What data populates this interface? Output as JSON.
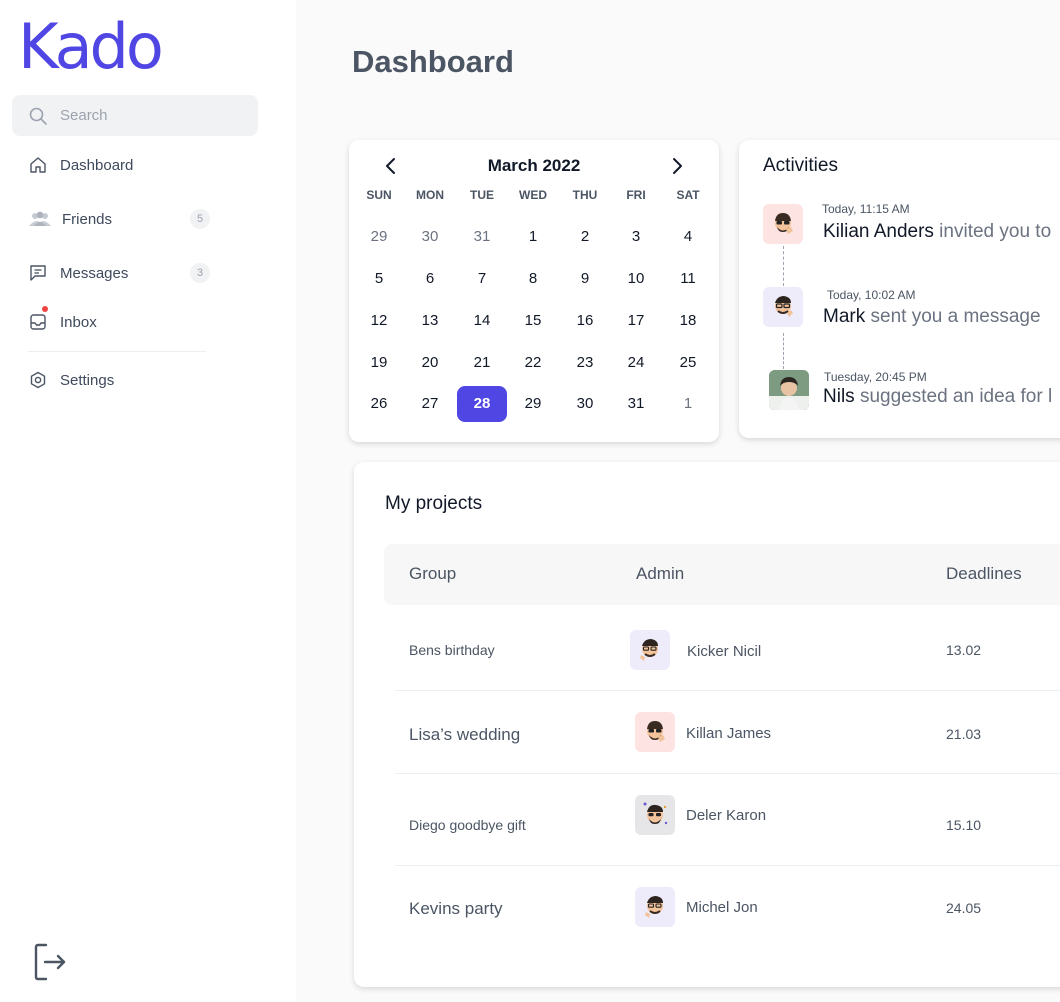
{
  "brand": {
    "logo": "Kado",
    "accent": "#5046e4"
  },
  "search": {
    "placeholder": "Search"
  },
  "sidebar": {
    "items": [
      {
        "label": "Dashboard",
        "icon": "home-icon"
      },
      {
        "label": "Friends",
        "icon": "users-icon",
        "count": "5"
      },
      {
        "label": "Messages",
        "icon": "message-icon",
        "count": "3"
      },
      {
        "label": "Inbox",
        "icon": "inbox-icon",
        "unread_dot": true
      },
      {
        "label": "Settings",
        "icon": "gear-icon"
      }
    ],
    "logout_icon": "logout-icon"
  },
  "page": {
    "title": "Dashboard"
  },
  "calendar": {
    "month_label": "March 2022",
    "weekdays": [
      "SUN",
      "MON",
      "TUE",
      "WED",
      "THU",
      "FRI",
      "SAT"
    ],
    "weeks": [
      [
        "29",
        "30",
        "31",
        "1",
        "2",
        "3",
        "4"
      ],
      [
        "5",
        "6",
        "7",
        "8",
        "9",
        "10",
        "11"
      ],
      [
        "12",
        "13",
        "14",
        "15",
        "16",
        "17",
        "18"
      ],
      [
        "19",
        "20",
        "21",
        "22",
        "23",
        "24",
        "25"
      ],
      [
        "26",
        "27",
        "28",
        "29",
        "30",
        "31",
        "1"
      ]
    ],
    "selected": "28"
  },
  "activities": {
    "title": "Activities",
    "items": [
      {
        "time": "Today, 11:15 AM",
        "who": "Kilian Anders",
        "text": " invited you to"
      },
      {
        "time": "Today, 10:02 AM",
        "who": "Mark",
        "text": " sent you a message"
      },
      {
        "time": "Tuesday, 20:45 PM",
        "who": "Nils",
        "text": " suggested an idea for l"
      }
    ]
  },
  "projects": {
    "title": "My projects",
    "columns": [
      "Group",
      "Admin",
      "Deadlines"
    ],
    "rows": [
      {
        "group": "Bens birthday",
        "admin": "Kicker Nicil",
        "deadline": "13.02"
      },
      {
        "group": "Lisa’s wedding",
        "admin": "Killan James",
        "deadline": "21.03"
      },
      {
        "group": "Diego goodbye gift",
        "admin": "Deler Karon",
        "deadline": "15.10"
      },
      {
        "group": "Kevins party",
        "admin": "Michel Jon",
        "deadline": "24.05"
      }
    ]
  }
}
